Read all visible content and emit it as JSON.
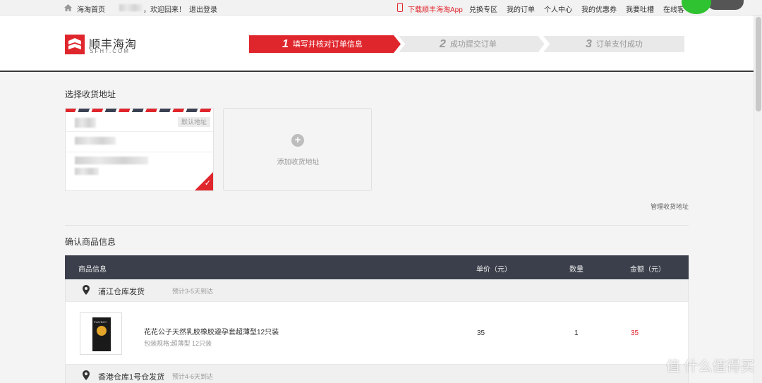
{
  "topbar": {
    "home_link": "海淘首页",
    "welcome": "，欢迎回来！",
    "logout": "退出登录",
    "download_app": "下载顺丰海淘App",
    "nav": [
      "兑换专区",
      "我的订单",
      "个人中心",
      "我的优惠券",
      "我要吐槽",
      "在线客"
    ]
  },
  "logo": {
    "name": "顺丰海淘",
    "sub": "SFHT.COM"
  },
  "steps": [
    {
      "num": "1",
      "label": "填写并核对订单信息",
      "active": true
    },
    {
      "num": "2",
      "label": "成功提交订单",
      "active": false
    },
    {
      "num": "3",
      "label": "订单支付成功",
      "active": false
    }
  ],
  "address": {
    "title": "选择收货地址",
    "default_tag": "默认地址",
    "add_label": "添加收货地址",
    "manage_link": "管理收货地址"
  },
  "goods": {
    "title": "确认商品信息",
    "columns": [
      "商品信息",
      "单价（元）",
      "数量",
      "金额（元）"
    ],
    "warehouses": [
      {
        "name": "浦江仓库发货",
        "eta": "预计3-5天到达"
      },
      {
        "name": "香港仓库1号仓发货",
        "eta": "预计4-6天到达"
      }
    ],
    "item": {
      "brand_text": "PLAYBOY",
      "name": "花花公子天然乳胶橡胶避孕套超薄型12只装",
      "spec": "包装规格:超薄型 12只装",
      "price": "35",
      "qty": "1",
      "amount": "35"
    }
  },
  "watermark": "值 什么值得买",
  "colors": {
    "accent": "#e0262d",
    "table_header": "#3a3f4b",
    "badge": "#2fc231"
  }
}
